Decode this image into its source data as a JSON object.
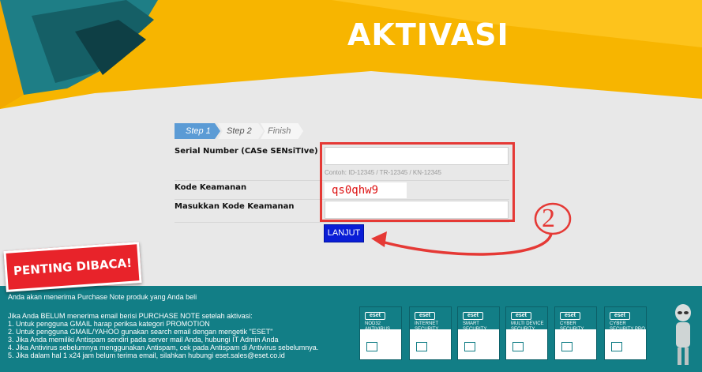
{
  "header": {
    "title": "AKTIVASI"
  },
  "steps": [
    "Step 1",
    "Step 2",
    "Finish"
  ],
  "form": {
    "serial_label": "Serial Number (CASe SENsiTIve)",
    "serial_value": "",
    "serial_hint": "Contoh: ID-12345 / TR-12345 / KN-12345",
    "security_label": "Kode Keamanan",
    "captcha_text": "qs0qhw9",
    "enter_code_label": "Masukkan Kode Keamanan",
    "enter_code_value": "",
    "submit_label": "LANJUT"
  },
  "annotation": {
    "number": "2"
  },
  "notice_badge": "PENTING DIBACA!",
  "footer": {
    "intro": "Anda akan menerima Purchase Note produk yang Anda beli",
    "lines": [
      "Jika Anda BELUM menerima email berisi PURCHASE NOTE setelah aktivasi:",
      "1. Untuk pengguna GMAIL harap periksa kategori PROMOTION",
      "2. Untuk pengguna GMAIL/YAHOO gunakan search email dengan mengetik \"ESET\"",
      "3. Jika Anda memiliki Antispam sendiri pada server mail Anda, hubungi IT Admin Anda",
      "4. Jika Antivirus sebelumnya menggunakan Antispam, cek pada Antispam di Antivirus sebelumnya.",
      "5. Jika dalam hal 1 x24 jam belum terima email, silahkan hubungi eset.sales@eset.co.id"
    ]
  },
  "products": [
    {
      "logo": "eset",
      "name": "NOD32 ANTIVIRUS"
    },
    {
      "logo": "eset",
      "name": "INTERNET SECURITY"
    },
    {
      "logo": "eset",
      "name": "SMART SECURITY"
    },
    {
      "logo": "eset",
      "name": "MULTI DEVICE SECURITY"
    },
    {
      "logo": "eset",
      "name": "CYBER SECURITY"
    },
    {
      "logo": "eset",
      "name": "CYBER SECURITY PRO"
    }
  ],
  "colors": {
    "accent": "#f7b500",
    "teal": "#127e86",
    "button": "#0a1dd6",
    "highlight": "#e53935"
  }
}
